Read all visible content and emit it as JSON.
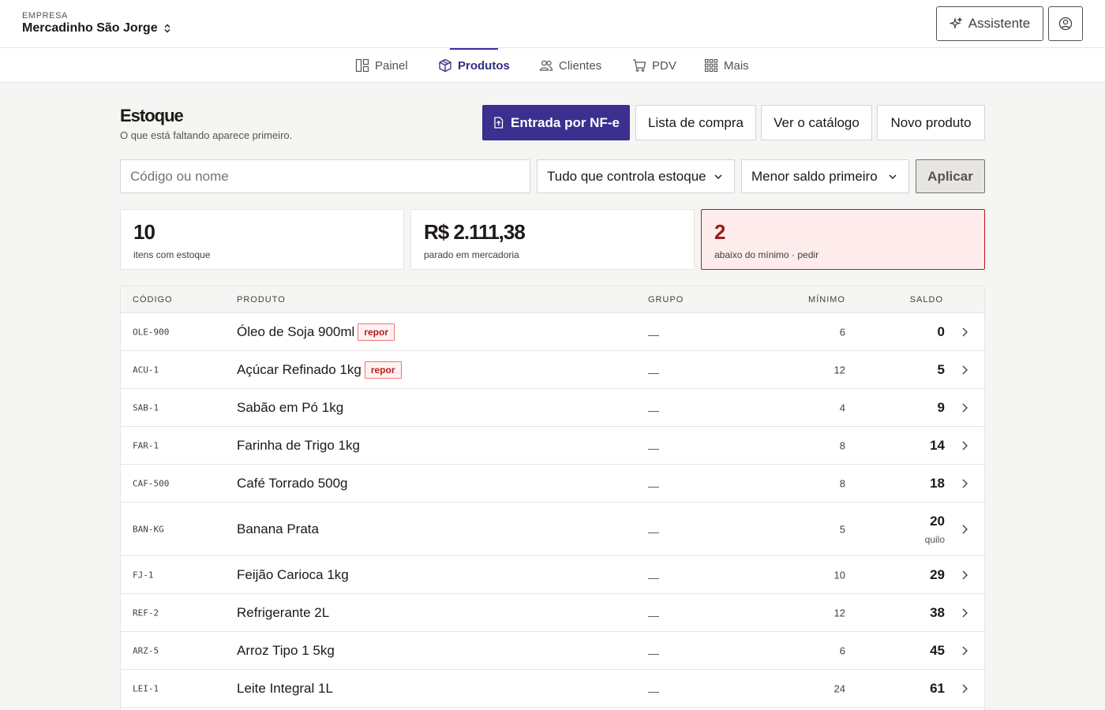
{
  "header": {
    "company_caption": "EMPRESA",
    "company_name": "Mercadinho São Jorge",
    "assistant_label": "Assistente"
  },
  "nav": {
    "items": [
      {
        "label": "Painel",
        "icon": "layout-icon"
      },
      {
        "label": "Produtos",
        "icon": "box-icon",
        "active": true
      },
      {
        "label": "Clientes",
        "icon": "users-icon"
      },
      {
        "label": "PDV",
        "icon": "cart-icon"
      },
      {
        "label": "Mais",
        "icon": "grid-icon"
      }
    ]
  },
  "page": {
    "title": "Estoque",
    "subtitle": "O que está faltando aparece primeiro."
  },
  "actions": {
    "nfe_label": "Entrada por NF-e",
    "lista_label": "Lista de compra",
    "catalogo_label": "Ver o catálogo",
    "novo_label": "Novo produto"
  },
  "filters": {
    "search_placeholder": "Código ou nome",
    "search_value": "",
    "filter_selected": "Tudo que controla estoque",
    "sort_selected": "Menor saldo primeiro",
    "apply_label": "Aplicar"
  },
  "stats": [
    {
      "value": "10",
      "label": "itens com estoque"
    },
    {
      "value": "R$ 2.111,38",
      "label": "parado em mercadoria"
    },
    {
      "value": "2",
      "label": "abaixo do mínimo · pedir"
    }
  ],
  "table": {
    "headers": {
      "codigo": "CÓDIGO",
      "produto": "PRODUTO",
      "grupo": "GRUPO",
      "minimo": "MÍNIMO",
      "saldo": "SALDO"
    },
    "rows": [
      {
        "code": "OLE-900",
        "product": "Óleo de Soja 900ml",
        "badge": "repor",
        "group": "—",
        "min": "6",
        "saldo": "0",
        "unit": ""
      },
      {
        "code": "ACU-1",
        "product": "Açúcar Refinado 1kg",
        "badge": "repor",
        "group": "—",
        "min": "12",
        "saldo": "5",
        "unit": ""
      },
      {
        "code": "SAB-1",
        "product": "Sabão em Pó 1kg",
        "badge": "",
        "group": "—",
        "min": "4",
        "saldo": "9",
        "unit": ""
      },
      {
        "code": "FAR-1",
        "product": "Farinha de Trigo 1kg",
        "badge": "",
        "group": "—",
        "min": "8",
        "saldo": "14",
        "unit": ""
      },
      {
        "code": "CAF-500",
        "product": "Café Torrado 500g",
        "badge": "",
        "group": "—",
        "min": "8",
        "saldo": "18",
        "unit": ""
      },
      {
        "code": "BAN-KG",
        "product": "Banana Prata",
        "badge": "",
        "group": "—",
        "min": "5",
        "saldo": "20",
        "unit": "quilo"
      },
      {
        "code": "FJ-1",
        "product": "Feijão Carioca 1kg",
        "badge": "",
        "group": "—",
        "min": "10",
        "saldo": "29",
        "unit": ""
      },
      {
        "code": "REF-2",
        "product": "Refrigerante 2L",
        "badge": "",
        "group": "—",
        "min": "12",
        "saldo": "38",
        "unit": ""
      },
      {
        "code": "ARZ-5",
        "product": "Arroz Tipo 1 5kg",
        "badge": "",
        "group": "—",
        "min": "6",
        "saldo": "45",
        "unit": ""
      },
      {
        "code": "LEI-1",
        "product": "Leite Integral 1L",
        "badge": "",
        "group": "—",
        "min": "24",
        "saldo": "61",
        "unit": ""
      }
    ]
  },
  "colors": {
    "brand": "#3b2f8f",
    "alert_bg": "#fdeceb",
    "alert_border": "#b91c1c",
    "alert_text": "#991b1b"
  }
}
